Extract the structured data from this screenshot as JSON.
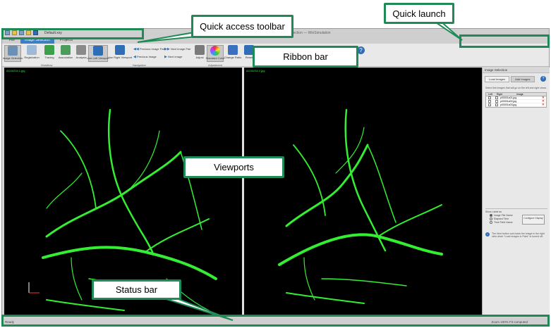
{
  "app": {
    "qat_project": "Default.xxy",
    "window_title": "Image Selection — WinSimulation",
    "tabs": [
      "File",
      "Image Selection",
      "Projects"
    ],
    "ribbon": {
      "workflow_buttons": [
        "Image Selection",
        "Registration",
        "Tracing",
        "Association",
        "Analysis"
      ],
      "viewport_buttons": [
        "Use Left Viewport",
        "Use Right Viewport"
      ],
      "nav_items": [
        "Previous Image Pair",
        "Next Image Pair",
        "Previous Image",
        "Next Image"
      ],
      "adjust_buttons": [
        "Adjust",
        "Standard Color",
        "Change Ratio"
      ],
      "extra_button": "Reset",
      "group_labels": [
        "Workflow",
        "Navigation",
        "Adjustment"
      ]
    },
    "viewport_left_label": "AC00234 1.jpg",
    "viewport_right_label": "AC00234 2.jpg",
    "side_panel": {
      "title": "Image Selection",
      "tab_load": "Load Images",
      "tab_add": "Add Images",
      "description": "Select the images that will go on the left and right views.",
      "table_headers": [
        "Left",
        "Right",
        "Image"
      ],
      "rows": [
        "p00001a01.jpg",
        "p00001a02.jpg",
        "p00001a03.jpg"
      ],
      "show_label_title": "Show Label as",
      "radio_options": [
        "Image File Name",
        "Elapsed Time",
        "Time Field Name"
      ],
      "configure_button": "Configure Display",
      "info_text": "The Next button sub-loads the image in the right view when \"Load Images in Pairs\" is turned off."
    },
    "status_left": "Ready",
    "status_right": "Zoom 100%   Fit computed"
  },
  "callouts": {
    "quick_access": "Quick access toolbar",
    "quick_launch": "Quick launch",
    "ribbon": "Ribbon bar",
    "viewports": "Viewports",
    "status": "Status bar"
  }
}
